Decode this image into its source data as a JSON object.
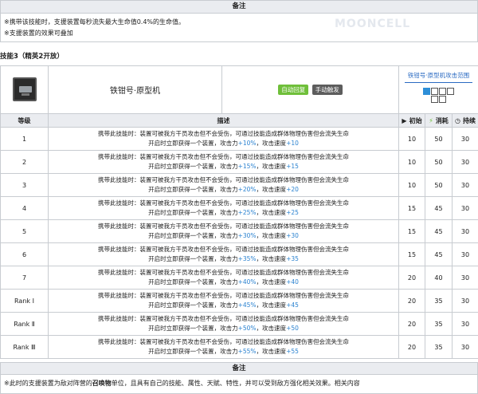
{
  "top_notes": {
    "header": "备注",
    "lines": [
      "※携带该技能时，支援装置每秒流失最大生命值0.4%的生命值。",
      "※支援装置的效果可叠加"
    ],
    "watermark": "MOONCELL"
  },
  "skill": {
    "title": "技能3（精英2开放）",
    "name": "铁钳号·原型机",
    "tags": [
      "自动回复",
      "手动触发"
    ],
    "range_title": "铁钳号·原型机攻击范围",
    "columns": [
      "等级",
      "描述",
      "初始",
      "消耗",
      "持续"
    ],
    "colors": {
      "auto_tag": "#6fbf3a",
      "manual_tag": "#5d5d5d",
      "value_blue": "#2a82d0",
      "range_self": "#2e8fd8"
    },
    "levels": [
      {
        "level": "1",
        "line1": "携带此技能时：装置可被我方干员攻击但不会受伤，可通过技能造成群体物理伤害但会流失生命",
        "line2a": "开启时立即获得一个装置，攻击力",
        "atk": "+10%",
        "line2b": "，攻击速度",
        "aspd": "+10",
        "init": "10",
        "cost": "50",
        "dur": "30"
      },
      {
        "level": "2",
        "line1": "携带此技能时：装置可被我方干员攻击但不会受伤，可通过技能造成群体物理伤害但会流失生命",
        "line2a": "开启时立即获得一个装置，攻击力",
        "atk": "+15%",
        "line2b": "，攻击速度",
        "aspd": "+15",
        "init": "10",
        "cost": "50",
        "dur": "30"
      },
      {
        "level": "3",
        "line1": "携带此技能时：装置可被我方干员攻击但不会受伤，可通过技能造成群体物理伤害但会流失生命",
        "line2a": "开启时立即获得一个装置，攻击力",
        "atk": "+20%",
        "line2b": "，攻击速度",
        "aspd": "+20",
        "init": "10",
        "cost": "50",
        "dur": "30"
      },
      {
        "level": "4",
        "line1": "携带此技能时：装置可被我方干员攻击但不会受伤，可通过技能造成群体物理伤害但会流失生命",
        "line2a": "开启时立即获得一个装置，攻击力",
        "atk": "+25%",
        "line2b": "，攻击速度",
        "aspd": "+25",
        "init": "15",
        "cost": "45",
        "dur": "30"
      },
      {
        "level": "5",
        "line1": "携带此技能时：装置可被我方干员攻击但不会受伤，可通过技能造成群体物理伤害但会流失生命",
        "line2a": "开启时立即获得一个装置，攻击力",
        "atk": "+30%",
        "line2b": "，攻击速度",
        "aspd": "+30",
        "init": "15",
        "cost": "45",
        "dur": "30"
      },
      {
        "level": "6",
        "line1": "携带此技能时：装置可被我方干员攻击但不会受伤，可通过技能造成群体物理伤害但会流失生命",
        "line2a": "开启时立即获得一个装置，攻击力",
        "atk": "+35%",
        "line2b": "，攻击速度",
        "aspd": "+35",
        "init": "15",
        "cost": "45",
        "dur": "30"
      },
      {
        "level": "7",
        "line1": "携带此技能时：装置可被我方干员攻击但不会受伤，可通过技能造成群体物理伤害但会流失生命",
        "line2a": "开启时立即获得一个装置，攻击力",
        "atk": "+40%",
        "line2b": "，攻击速度",
        "aspd": "+40",
        "init": "20",
        "cost": "40",
        "dur": "30"
      },
      {
        "level": "Rank Ⅰ",
        "line1": "携带此技能时：装置可被我方干员攻击但不会受伤，可通过技能造成群体物理伤害但会流失生命",
        "line2a": "开启时立即获得一个装置，攻击力",
        "atk": "+45%",
        "line2b": "，攻击速度",
        "aspd": "+45",
        "init": "20",
        "cost": "35",
        "dur": "30"
      },
      {
        "level": "Rank Ⅱ",
        "line1": "携带此技能时：装置可被我方干员攻击但不会受伤，可通过技能造成群体物理伤害但会流失生命",
        "line2a": "开启时立即获得一个装置，攻击力",
        "atk": "+50%",
        "line2b": "，攻击速度",
        "aspd": "+50",
        "init": "20",
        "cost": "35",
        "dur": "30"
      },
      {
        "level": "Rank Ⅲ",
        "line1": "携带此技能时：装置可被我方干员攻击但不会受伤，可通过技能造成群体物理伤害但会流失生命",
        "line2a": "开启时立即获得一个装置，攻击力",
        "atk": "+55%",
        "line2b": "，攻击速度",
        "aspd": "+55",
        "init": "20",
        "cost": "35",
        "dur": "30"
      }
    ]
  },
  "bottom_notes": {
    "header": "备注",
    "text_a": "※此时的支援装置为敌对阵营的",
    "text_bold": "召唤物",
    "text_b": "单位，且具有自己的技能、属性、天赋、特性，并可以受到敌方强化相关效果。相关内容"
  }
}
